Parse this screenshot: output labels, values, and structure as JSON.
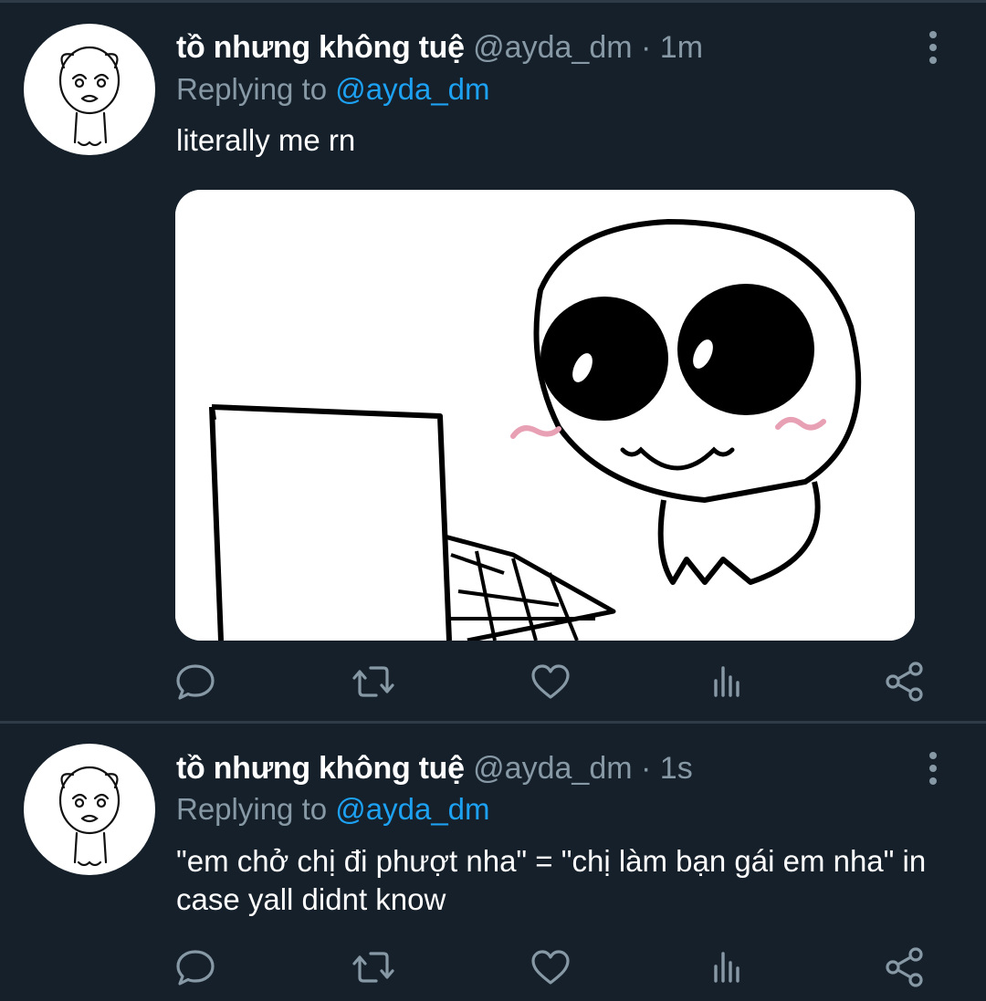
{
  "tweets": [
    {
      "display_name": "tồ nhưng không tuệ",
      "handle": "@ayda_dm",
      "separator": "·",
      "time": "1m",
      "replying_prefix": "Replying to ",
      "replying_to": "@ayda_dm",
      "text": "literally me rn",
      "has_media": true
    },
    {
      "display_name": "tồ nhưng không tuệ",
      "handle": "@ayda_dm",
      "separator": "·",
      "time": "1s",
      "replying_prefix": "Replying to ",
      "replying_to": "@ayda_dm",
      "text": "\"em chở chị đi phượt nha\" = \"chị làm bạn gái em nha\" in case yall didnt know",
      "has_media": false
    }
  ],
  "actions": [
    "reply-icon",
    "retweet-icon",
    "like-icon",
    "analytics-icon",
    "share-icon"
  ],
  "colors": {
    "background": "#15202b",
    "divider": "#2f3b47",
    "secondary_text": "#8899a6",
    "mention": "#1da1f2",
    "primary_text": "#ffffff"
  }
}
